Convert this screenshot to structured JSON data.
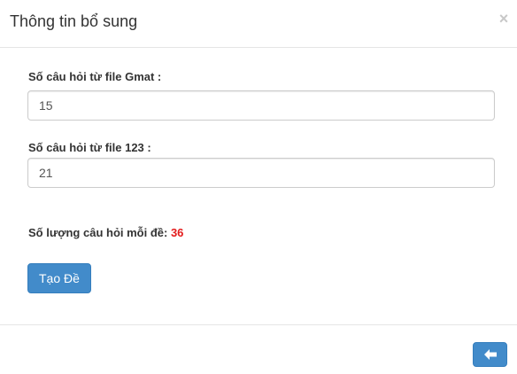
{
  "modal": {
    "title": "Thông tin bổ sung",
    "close_glyph": "×"
  },
  "fields": [
    {
      "label": "Số câu hỏi từ file Gmat :",
      "value": "15"
    },
    {
      "label": "Số câu hỏi từ file 123 :",
      "value": "21"
    }
  ],
  "summary": {
    "label": "Số lượng câu hỏi mỗi đề:",
    "value": "36",
    "value_color": "#e31b1b"
  },
  "actions": {
    "create_label": "Tạo Đề",
    "back_icon": "arrow-left-icon"
  },
  "colors": {
    "primary": "#428bca"
  }
}
